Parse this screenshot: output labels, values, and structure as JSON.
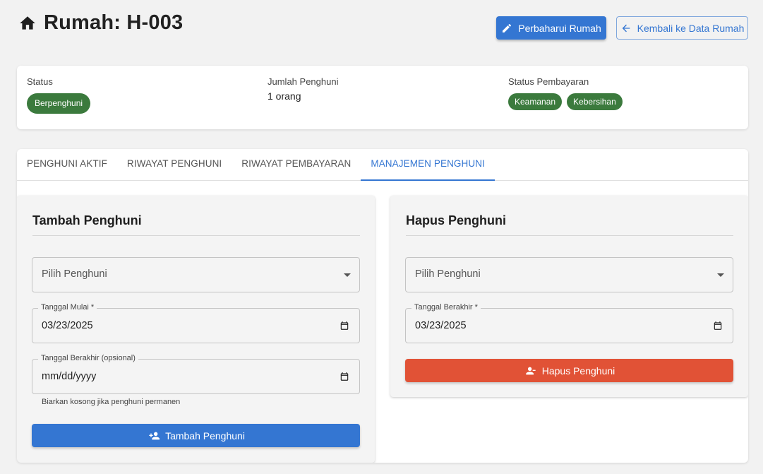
{
  "header": {
    "title": "Rumah: H-003",
    "icon": "home-icon"
  },
  "actions": {
    "update_label": "Perbaharui Rumah",
    "back_label": "Kembali ke Data Rumah"
  },
  "summary": {
    "status_label": "Status",
    "status_value": "Berpenghuni",
    "residents_label": "Jumlah Penghuni",
    "residents_value": "1 orang",
    "payment_label": "Status Pembayaran",
    "payment_chips": [
      "Keamanan",
      "Kebersihan"
    ]
  },
  "tabs": [
    {
      "label": "PENGHUNI AKTIF",
      "active": false
    },
    {
      "label": "RIWAYAT PENGHUNI",
      "active": false
    },
    {
      "label": "RIWAYAT PEMBAYARAN",
      "active": false
    },
    {
      "label": "MANAJEMEN PENGHUNI",
      "active": true
    }
  ],
  "add_panel": {
    "title": "Tambah Penghuni",
    "select_placeholder": "Pilih Penghuni",
    "start_label": "Tanggal Mulai *",
    "start_value": "03/23/2025",
    "end_label": "Tanggal Berakhir (opsional)",
    "end_value": "mm/dd/yyyy",
    "helper": "Biarkan kosong jika penghuni permanen",
    "button_label": "Tambah Penghuni"
  },
  "remove_panel": {
    "title": "Hapus Penghuni",
    "select_placeholder": "Pilih Penghuni",
    "end_label": "Tanggal Berakhir *",
    "end_value": "03/23/2025",
    "button_label": "Hapus Penghuni"
  },
  "colors": {
    "primary": "#3476d2",
    "success": "#3b7a3d",
    "danger": "#e15236"
  }
}
